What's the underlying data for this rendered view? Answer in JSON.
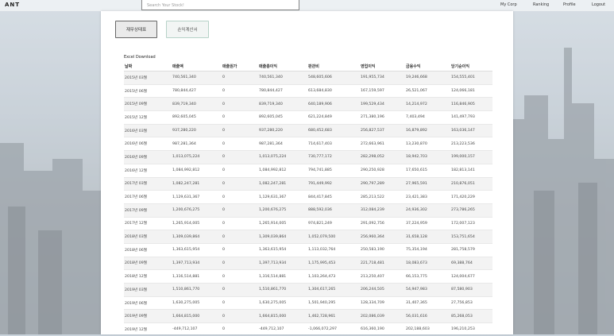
{
  "app": {
    "logo": "ANT"
  },
  "search": {
    "placeholder": "Search Your Stock!"
  },
  "nav": {
    "my_corp": "My Corp",
    "ranking": "Ranking",
    "profile": "Profile",
    "logout": "Logout"
  },
  "buttons": {
    "financial_statements": "재무상태표",
    "income_statement": "손익계산서"
  },
  "excel_label": "Excel Download",
  "table": {
    "headers": [
      "날짜",
      "매출액",
      "매출원가",
      "매출총이익",
      "판관비",
      "영업이익",
      "금융수익",
      "당기순이익"
    ],
    "rows": [
      [
        "2015년 03월",
        "740,561,340",
        "0",
        "740,561,340",
        "548,605,606",
        "191,955,734",
        "19,246,668",
        "154,555,401"
      ],
      [
        "2015년 06월",
        "780,844,427",
        "0",
        "780,844,427",
        "613,684,830",
        "167,159,597",
        "26,521,067",
        "124,066,181"
      ],
      [
        "2015년 09월",
        "839,719,340",
        "0",
        "839,719,340",
        "640,189,906",
        "199,529,434",
        "14,214,972",
        "116,846,905"
      ],
      [
        "2015년 12월",
        "892,605,045",
        "0",
        "892,605,045",
        "621,224,849",
        "271,380,196",
        "7,403,494",
        "141,497,793"
      ],
      [
        "2016년 03월",
        "937,280,220",
        "0",
        "937,280,220",
        "680,452,683",
        "256,827,537",
        "16,879,892",
        "163,036,147"
      ],
      [
        "2016년 06월",
        "987,281,364",
        "0",
        "987,281,364",
        "714,617,403",
        "272,663,961",
        "13,230,870",
        "213,223,536"
      ],
      [
        "2016년 09월",
        "1,013,075,224",
        "0",
        "1,013,075,224",
        "730,777,172",
        "282,298,052",
        "18,942,703",
        "199,000,157"
      ],
      [
        "2016년 12월",
        "1,084,992,812",
        "0",
        "1,084,992,812",
        "794,741,885",
        "290,250,928",
        "17,650,615",
        "182,813,141"
      ],
      [
        "2017년 03월",
        "1,082,247,281",
        "0",
        "1,082,247,281",
        "791,449,992",
        "290,797,289",
        "27,965,591",
        "210,876,051"
      ],
      [
        "2017년 06월",
        "1,129,631,367",
        "0",
        "1,129,631,367",
        "844,417,845",
        "285,213,522",
        "23,421,383",
        "171,420,229"
      ],
      [
        "2017년 09월",
        "1,200,676,275",
        "0",
        "1,200,676,275",
        "888,592,036",
        "312,084,239",
        "24,936,302",
        "273,786,265"
      ],
      [
        "2017년 12월",
        "1,265,914,005",
        "0",
        "1,265,914,005",
        "974,821,249",
        "291,092,756",
        "37,224,959",
        "172,007,123"
      ],
      [
        "2018년 03월",
        "1,309,039,864",
        "0",
        "1,309,039,864",
        "1,052,079,500",
        "256,960,364",
        "31,658,128",
        "153,751,654"
      ],
      [
        "2018년 06월",
        "1,363,615,954",
        "0",
        "1,363,615,954",
        "1,113,032,764",
        "250,583,190",
        "75,354,194",
        "281,758,579"
      ],
      [
        "2018년 09월",
        "1,397,713,934",
        "0",
        "1,397,713,934",
        "1,175,995,453",
        "221,718,481",
        "18,083,673",
        "69,388,764"
      ],
      [
        "2018년 12월",
        "1,316,514,881",
        "0",
        "1,316,514,881",
        "1,103,264,473",
        "213,250,407",
        "66,153,775",
        "124,004,677"
      ],
      [
        "2019년 03월",
        "1,510,861,770",
        "0",
        "1,510,861,770",
        "1,304,617,265",
        "206,244,505",
        "54,947,983",
        "87,580,903"
      ],
      [
        "2019년 06월",
        "1,630,275,005",
        "0",
        "1,630,275,005",
        "1,501,940,295",
        "128,334,709",
        "31,407,365",
        "27,756,853"
      ],
      [
        "2019년 09월",
        "1,664,815,000",
        "0",
        "1,664,815,000",
        "1,462,728,961",
        "202,086,039",
        "56,031,616",
        "85,268,053"
      ],
      [
        "2019년 12월",
        "-449,712,107",
        "0",
        "-449,712,107",
        "-1,066,072,297",
        "616,360,190",
        "202,188,603",
        "196,210,253"
      ]
    ]
  }
}
